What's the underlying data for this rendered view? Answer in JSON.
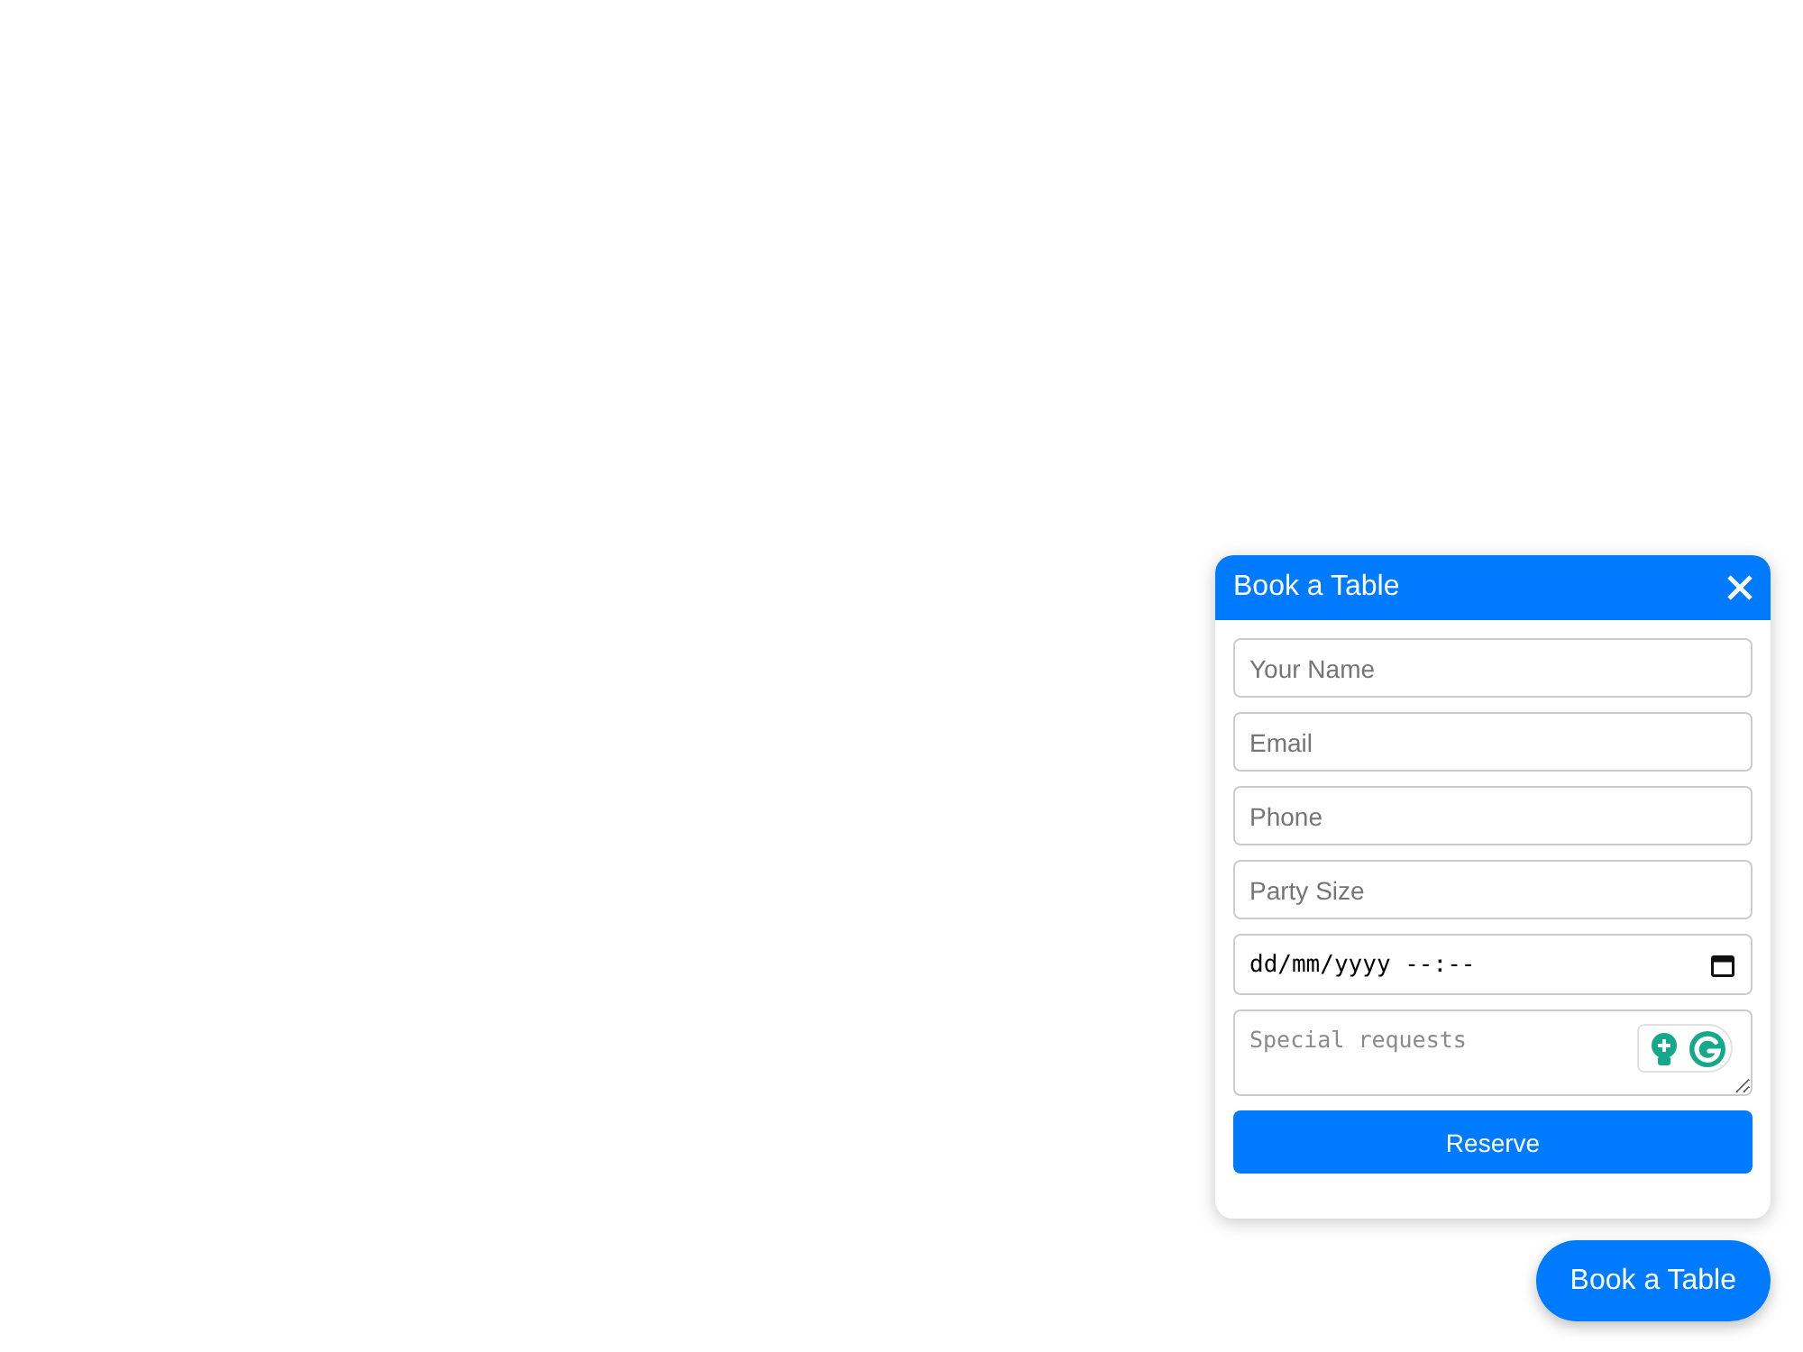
{
  "widget": {
    "title": "Book a Table",
    "fields": [
      {
        "kind": "text",
        "placeholder": "Your Name"
      },
      {
        "kind": "text",
        "placeholder": "Email"
      },
      {
        "kind": "text",
        "placeholder": "Phone"
      },
      {
        "kind": "text",
        "placeholder": "Party Size"
      },
      {
        "kind": "datetime",
        "value": "dd/mm/yyyy --:--"
      },
      {
        "kind": "textarea",
        "placeholder": "Special requests"
      }
    ],
    "submit": "Reserve"
  },
  "launcher": {
    "label": "Book a Table"
  }
}
